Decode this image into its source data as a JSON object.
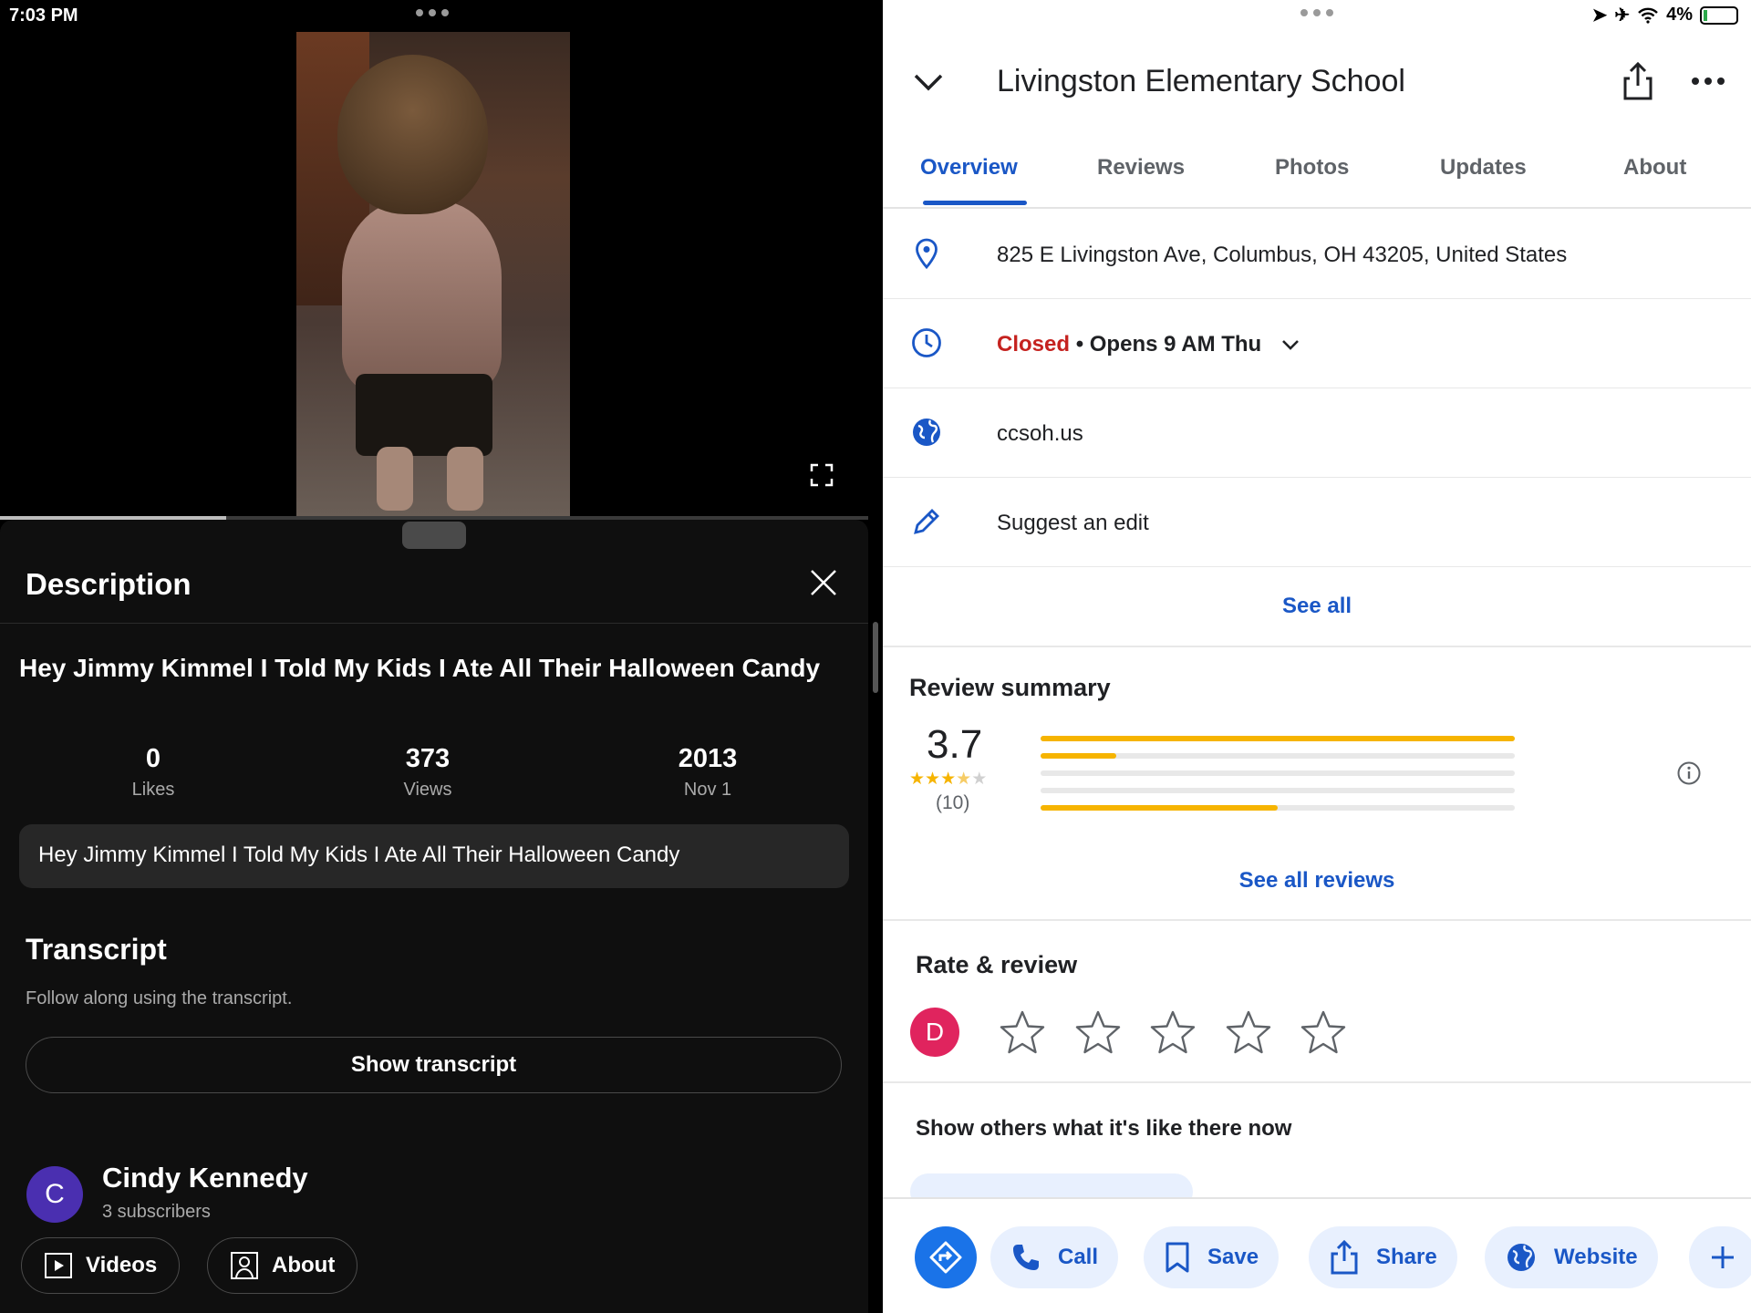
{
  "status_bar": {
    "time": "7:03 PM",
    "battery": "4%"
  },
  "youtube": {
    "description_header": "Description",
    "video_title": "Hey Jimmy Kimmel I Told My Kids I Ate All Their Halloween Candy",
    "playback_progress": 0.26,
    "stats": [
      {
        "value": "0",
        "label": "Likes"
      },
      {
        "value": "373",
        "label": "Views"
      },
      {
        "value": "2013",
        "label": "Nov 1"
      }
    ],
    "description_text": "Hey Jimmy Kimmel I Told My Kids I Ate All Their Halloween Candy",
    "transcript_header": "Transcript",
    "transcript_sub": "Follow along using the transcript.",
    "show_transcript_label": "Show transcript",
    "channel": {
      "initial": "C",
      "name": "Cindy Kennedy",
      "subscribers": "3 subscribers"
    },
    "videos_label": "Videos",
    "about_label": "About"
  },
  "maps": {
    "place_title": "Livingston Elementary School",
    "tabs": [
      "Overview",
      "Reviews",
      "Photos",
      "Updates",
      "About"
    ],
    "address": "825 E Livingston Ave, Columbus, OH 43205, United States",
    "hours_status": "Closed",
    "hours_separator": "•",
    "hours_next": "Opens 9 AM Thu",
    "website": "ccsoh.us",
    "suggest_edit": "Suggest an edit",
    "see_all": "See all",
    "review_summary_header": "Review summary",
    "rating": "3.7",
    "rating_stars_value": 3.5,
    "rating_count": "(10)",
    "rating_bars": [
      {
        "stars": 5,
        "fraction": 1.0
      },
      {
        "stars": 4,
        "fraction": 0.16
      },
      {
        "stars": 3,
        "fraction": 0.0
      },
      {
        "stars": 2,
        "fraction": 0.0
      },
      {
        "stars": 1,
        "fraction": 0.5
      }
    ],
    "see_all_reviews": "See all reviews",
    "rate_review_header": "Rate & review",
    "user_initial": "D",
    "others_header": "Show others what it's like there now",
    "actions": {
      "call": "Call",
      "save": "Save",
      "share": "Share",
      "website": "Website"
    },
    "colors": {
      "accent": "#1a57c6",
      "closed": "#c5221f",
      "star": "#f6b400",
      "avatar": "#e0245e"
    }
  }
}
